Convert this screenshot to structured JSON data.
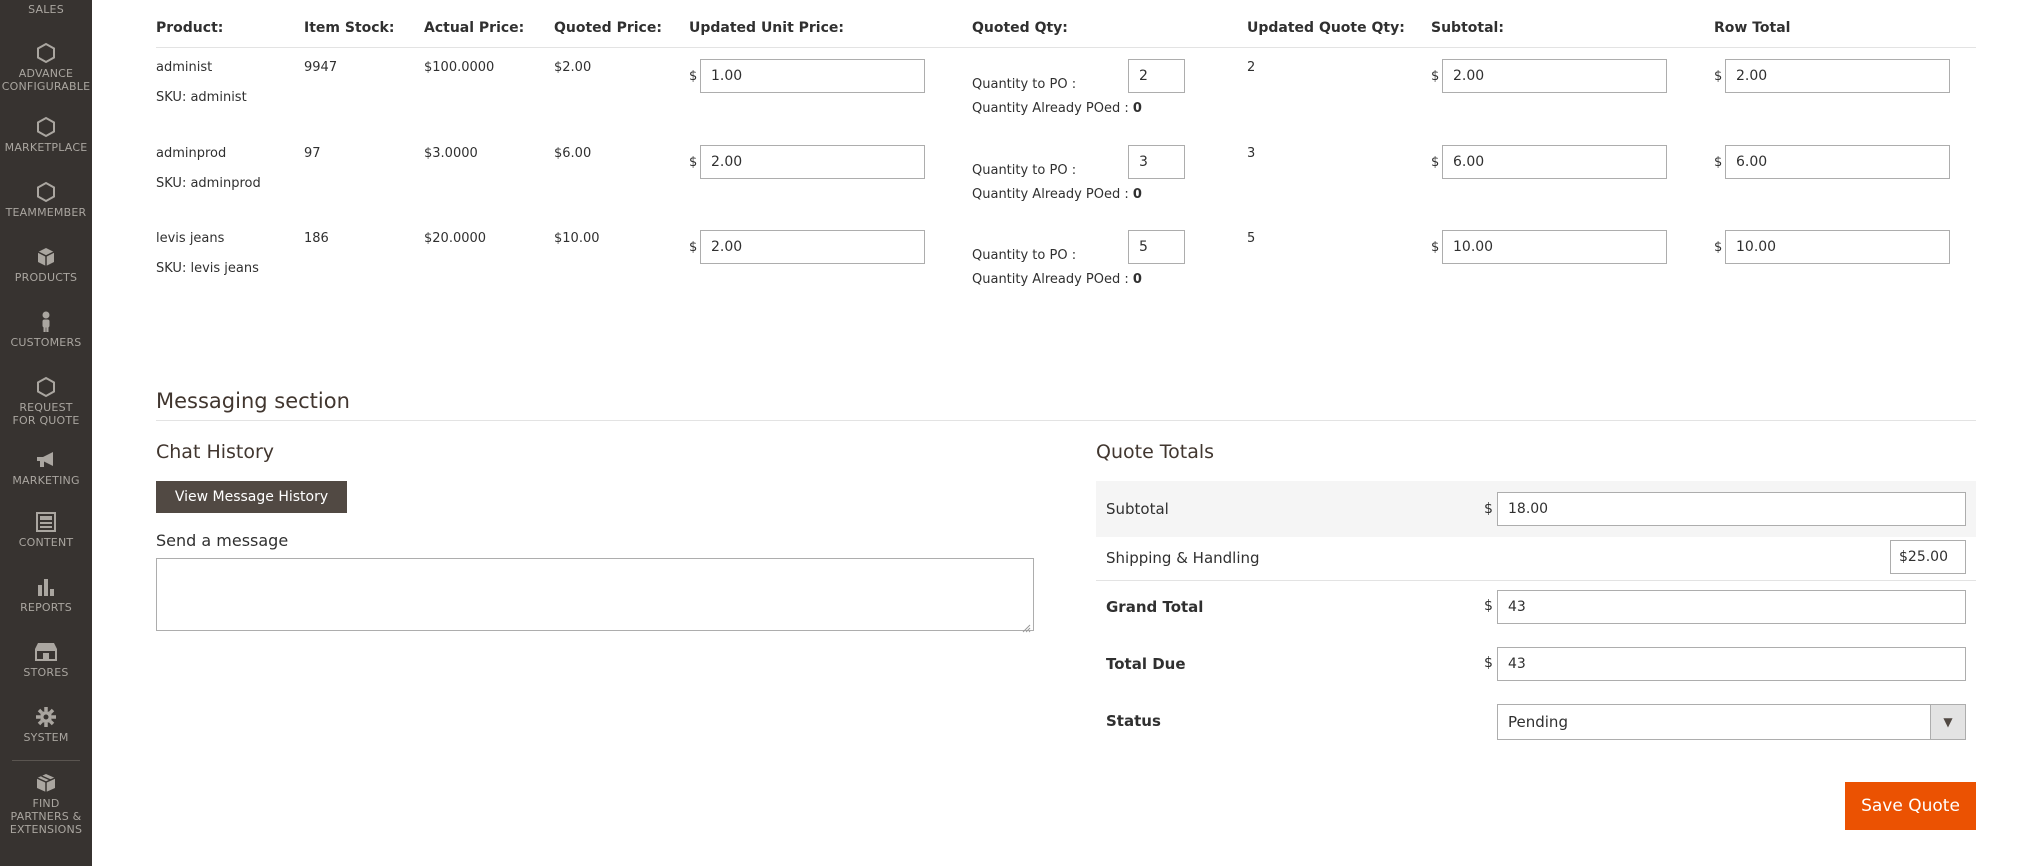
{
  "sidebar": {
    "items": [
      {
        "label": "SALES",
        "icon": "sales-icon"
      },
      {
        "label": "ADVANCE CONFIGURABLE",
        "icon": "hexagon-icon"
      },
      {
        "label": "MARKETPLACE",
        "icon": "hexagon-icon"
      },
      {
        "label": "TEAMMEMBER",
        "icon": "hexagon-icon"
      },
      {
        "label": "PRODUCTS",
        "icon": "cube-icon"
      },
      {
        "label": "CUSTOMERS",
        "icon": "person-icon"
      },
      {
        "label": "REQUEST FOR QUOTE",
        "icon": "hexagon-icon"
      },
      {
        "label": "MARKETING",
        "icon": "megaphone-icon"
      },
      {
        "label": "CONTENT",
        "icon": "layout-icon"
      },
      {
        "label": "REPORTS",
        "icon": "bar-chart-icon"
      },
      {
        "label": "STORES",
        "icon": "storefront-icon"
      },
      {
        "label": "SYSTEM",
        "icon": "gear-icon"
      },
      {
        "label": "FIND PARTNERS & EXTENSIONS",
        "icon": "box-icon"
      }
    ]
  },
  "table": {
    "headers": {
      "product": "Product:",
      "item_stock": "Item Stock:",
      "actual_price": "Actual Price:",
      "quoted_price": "Quoted Price:",
      "updated_unit_price": "Updated Unit Price:",
      "quoted_qty": "Quoted Qty:",
      "updated_quote_qty": "Updated Quote Qty:",
      "subtotal": "Subtotal:",
      "row_total": "Row Total"
    },
    "currency_symbol": "$",
    "qty_to_po_label": "Quantity to PO :",
    "qty_already_poed_label": "Quantity Already POed :",
    "rows": [
      {
        "product": "administ",
        "sku": "SKU: administ",
        "stock": "9947",
        "actual_price": "$100.0000",
        "quoted_price": "$2.00",
        "updated_unit_price": "1.00",
        "qty_to_po": "2",
        "already_poed": "0",
        "updated_quote_qty": "2",
        "subtotal": "2.00",
        "row_total": "2.00"
      },
      {
        "product": "adminprod",
        "sku": "SKU: adminprod",
        "stock": "97",
        "actual_price": "$3.0000",
        "quoted_price": "$6.00",
        "updated_unit_price": "2.00",
        "qty_to_po": "3",
        "already_poed": "0",
        "updated_quote_qty": "3",
        "subtotal": "6.00",
        "row_total": "6.00"
      },
      {
        "product": "levis jeans",
        "sku": "SKU: levis jeans",
        "stock": "186",
        "actual_price": "$20.0000",
        "quoted_price": "$10.00",
        "updated_unit_price": "2.00",
        "qty_to_po": "5",
        "already_poed": "0",
        "updated_quote_qty": "5",
        "subtotal": "10.00",
        "row_total": "10.00"
      }
    ]
  },
  "messaging": {
    "section_title": "Messaging section",
    "chat_history_title": "Chat History",
    "view_history_button": "View Message History",
    "send_message_label": "Send a message",
    "message_value": ""
  },
  "totals": {
    "title": "Quote Totals",
    "subtotal_label": "Subtotal",
    "subtotal_value": "18.00",
    "shipping_label": "Shipping & Handling",
    "shipping_value": "$25.00",
    "grand_total_label": "Grand Total",
    "grand_total_value": "43",
    "total_due_label": "Total Due",
    "total_due_value": "43",
    "status_label": "Status",
    "status_value": "Pending",
    "currency_symbol": "$"
  },
  "actions": {
    "save_quote": "Save Quote"
  },
  "colors": {
    "sidebar_bg": "#373330",
    "primary_button": "#eb5202",
    "dark_button": "#514943"
  }
}
